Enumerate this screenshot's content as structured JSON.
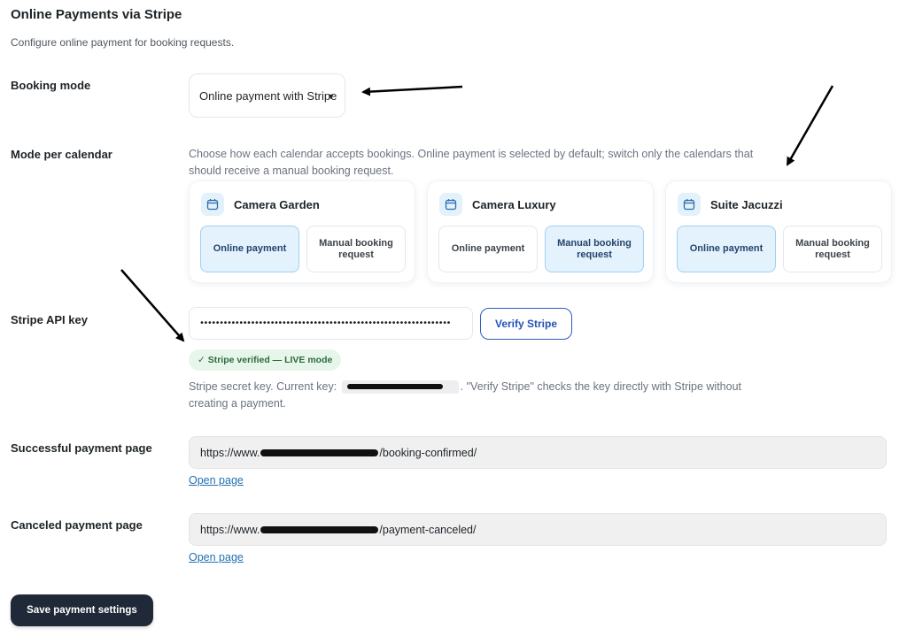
{
  "page": {
    "title": "Online Payments via Stripe",
    "description": "Configure online payment for booking requests."
  },
  "booking_mode": {
    "label": "Booking mode",
    "selected": "Online payment with Stripe"
  },
  "mode_per_calendar": {
    "label": "Mode per calendar",
    "hint": "Choose how each calendar accepts bookings. Online payment is selected by default; switch only the calendars that should receive a manual booking request.",
    "calendars": [
      {
        "name": "Camera Garden",
        "option_online": "Online payment",
        "option_manual": "Manual booking request",
        "selected": "online"
      },
      {
        "name": "Camera Luxury",
        "option_online": "Online payment",
        "option_manual": "Manual booking request",
        "selected": "manual"
      },
      {
        "name": "Suite Jacuzzi",
        "option_online": "Online payment",
        "option_manual": "Manual booking request",
        "selected": "online"
      }
    ]
  },
  "stripe_api_key": {
    "label": "Stripe API key",
    "masked_value": "••••••••••••••••••••••••••••••••••••••••••••••••••••••••••••••••",
    "verify_button": "Verify Stripe",
    "status_badge": "✓ Stripe verified — LIVE mode",
    "hint_prefix": "Stripe secret key. Current key:",
    "hint_suffix": ". \"Verify Stripe\" checks the key directly with Stripe without",
    "hint_line2": "creating a payment."
  },
  "successful_page": {
    "label": "Successful payment page",
    "url_prefix": "https://www.",
    "url_suffix": "/booking-confirmed/",
    "link": "Open page"
  },
  "canceled_page": {
    "label": "Canceled payment page",
    "url_prefix": "https://www.",
    "url_suffix": "/payment-canceled/",
    "link": "Open page"
  },
  "save_button": "Save payment settings",
  "colors": {
    "accent": "#2552b8",
    "selected_option_bg": "#e3f2fd",
    "verified_bg": "#e7f6ea",
    "save_bg": "#1f2937"
  },
  "icons": {
    "calendar": "calendar-icon",
    "dropdown": "chevron-down-icon",
    "annotation": "arrow-annotation"
  }
}
